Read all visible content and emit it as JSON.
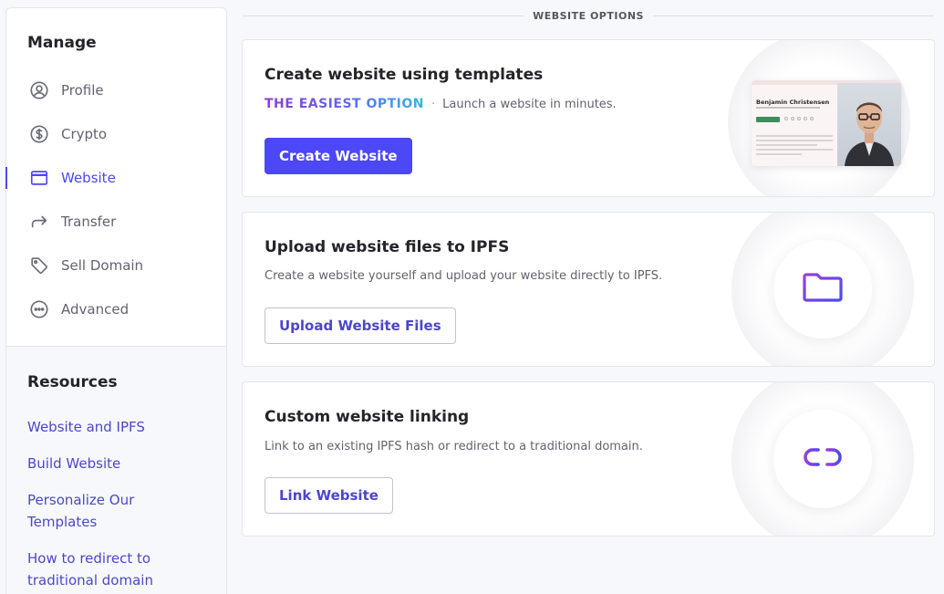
{
  "sidebar": {
    "manage_heading": "Manage",
    "items": [
      {
        "label": "Profile",
        "icon": "user-circle-icon",
        "active": false
      },
      {
        "label": "Crypto",
        "icon": "dollar-circle-icon",
        "active": false
      },
      {
        "label": "Website",
        "icon": "browser-window-icon",
        "active": true
      },
      {
        "label": "Transfer",
        "icon": "forward-arrow-icon",
        "active": false
      },
      {
        "label": "Sell Domain",
        "icon": "tag-icon",
        "active": false
      },
      {
        "label": "Advanced",
        "icon": "more-circle-icon",
        "active": false
      }
    ],
    "resources_heading": "Resources",
    "resources": [
      "Website and IPFS",
      "Build Website",
      "Personalize Our Templates",
      "How to redirect to traditional domain"
    ]
  },
  "main": {
    "section_title": "WEBSITE OPTIONS",
    "cards": [
      {
        "title": "Create website using templates",
        "tag_highlight": "THE EASIEST OPTION",
        "tag_separator": "·",
        "description": "Launch a website in minutes.",
        "button": "Create Website",
        "preview_name": "Benjamin Christensen"
      },
      {
        "title": "Upload website files to IPFS",
        "description": "Create a website yourself and upload your website directly to IPFS.",
        "button": "Upload Website Files",
        "icon": "folder-icon"
      },
      {
        "title": "Custom website linking",
        "description": "Link to an existing IPFS hash or redirect to a traditional domain.",
        "button": "Link Website",
        "icon": "link-icon"
      }
    ]
  },
  "colors": {
    "accent": "#4c47f7",
    "link": "#4c47c9",
    "gradient_start": "#8a3fd1",
    "gradient_end": "#35b6e0"
  }
}
